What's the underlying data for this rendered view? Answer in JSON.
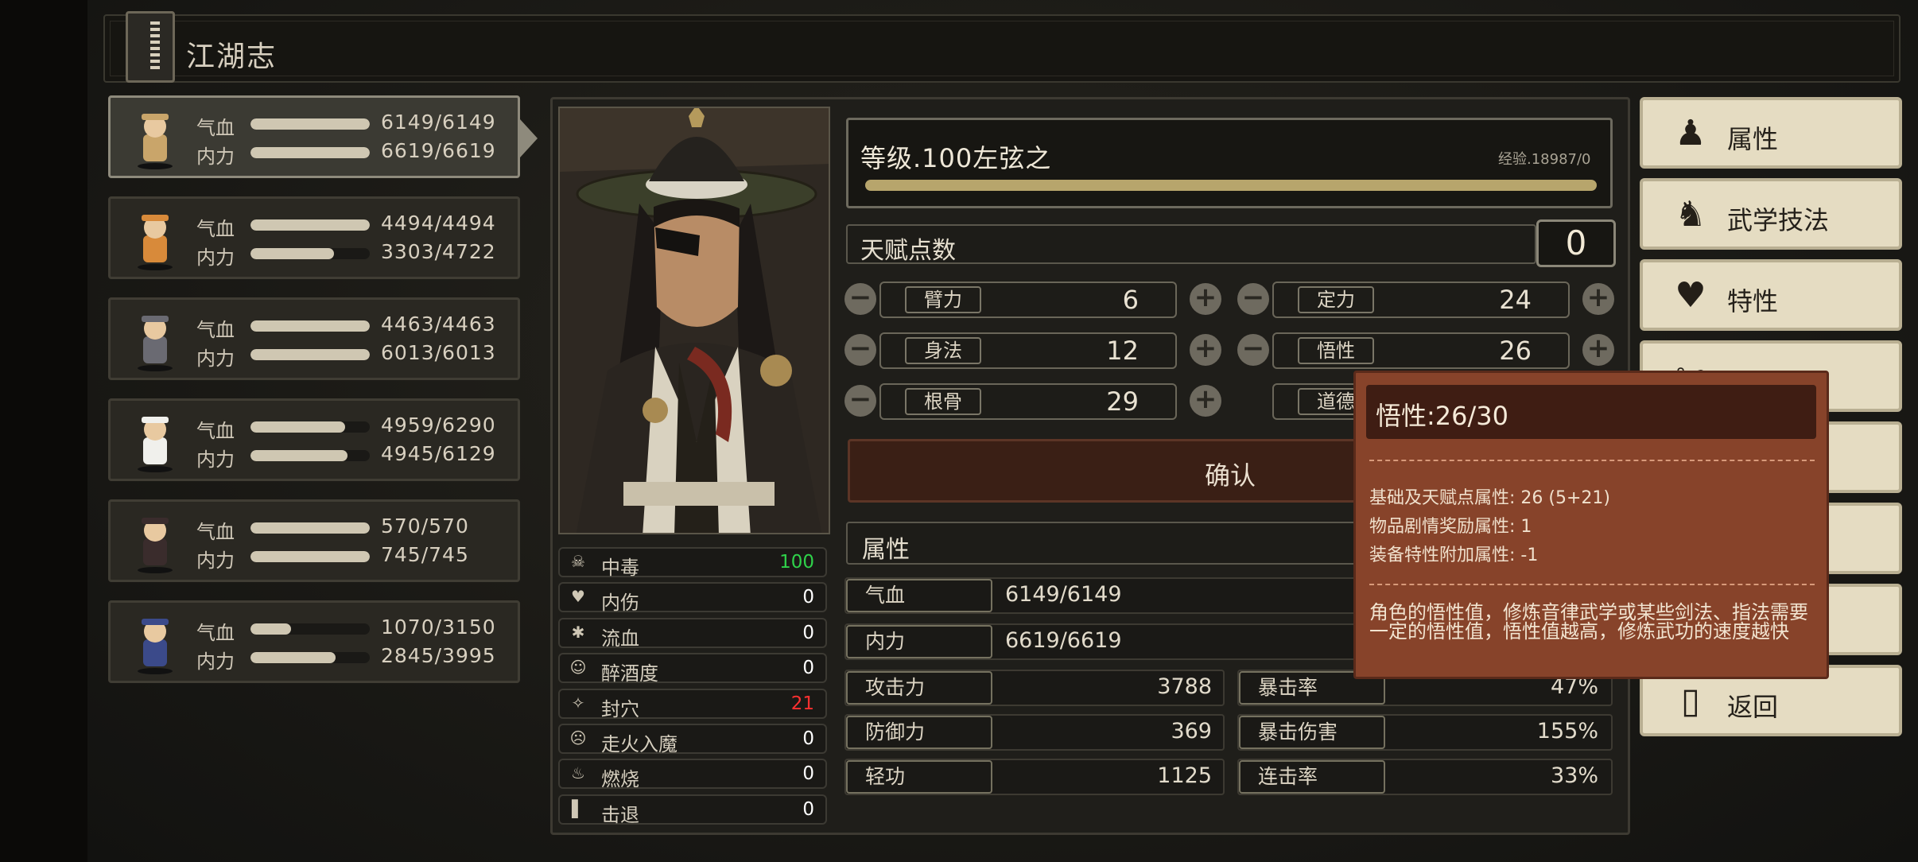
{
  "header": {
    "title": "江湖志"
  },
  "roster": [
    {
      "hp_label": "气血",
      "mp_label": "内力",
      "hp": "6149/6149",
      "mp": "6619/6619",
      "hp_frac": 1.0,
      "mp_frac": 1.0,
      "icon": "straw-hat-swordsman-icon"
    },
    {
      "hp_label": "气血",
      "mp_label": "内力",
      "hp": "4494/4494",
      "mp": "3303/4722",
      "hp_frac": 1.0,
      "mp_frac": 0.7,
      "icon": "fox-icon"
    },
    {
      "hp_label": "气血",
      "mp_label": "内力",
      "hp": "4463/4463",
      "mp": "6013/6013",
      "hp_frac": 1.0,
      "mp_frac": 1.0,
      "icon": "official-hat-man-icon"
    },
    {
      "hp_label": "气血",
      "mp_label": "内力",
      "hp": "4959/6290",
      "mp": "4945/6129",
      "hp_frac": 0.79,
      "mp_frac": 0.81,
      "icon": "white-goose-icon"
    },
    {
      "hp_label": "气血",
      "mp_label": "内力",
      "hp": "570/570",
      "mp": "745/745",
      "hp_frac": 1.0,
      "mp_frac": 1.0,
      "icon": "masked-ninja-icon"
    },
    {
      "hp_label": "气血",
      "mp_label": "内力",
      "hp": "1070/3150",
      "mp": "2845/3995",
      "hp_frac": 0.34,
      "mp_frac": 0.71,
      "icon": "blue-hat-fighter-icon"
    }
  ],
  "character": {
    "level_title": "等级.100左弦之",
    "exp": "经验.18987/0",
    "talent_label": "天赋点数",
    "talent_points": "0",
    "attributes": [
      {
        "name": "臂力",
        "value": "6"
      },
      {
        "name": "定力",
        "value": "24"
      },
      {
        "name": "身法",
        "value": "12"
      },
      {
        "name": "悟性",
        "value": "26"
      },
      {
        "name": "根骨",
        "value": "29"
      },
      {
        "name": "道德",
        "value": ""
      }
    ],
    "confirm_label": "确认"
  },
  "status_effects": [
    {
      "name": "中毒",
      "value": "100",
      "color": "#2fd14a",
      "icon": "skull-icon"
    },
    {
      "name": "内伤",
      "value": "0",
      "color": "#ffffff",
      "icon": "broken-heart-icon"
    },
    {
      "name": "流血",
      "value": "0",
      "color": "#ffffff",
      "icon": "blood-drop-icon"
    },
    {
      "name": "醉酒度",
      "value": "0",
      "color": "#ffffff",
      "icon": "dizzy-face-icon"
    },
    {
      "name": "封穴",
      "value": "21",
      "color": "#ff3030",
      "icon": "acupoint-seal-icon"
    },
    {
      "name": "走火入魔",
      "value": "0",
      "color": "#ffffff",
      "icon": "demon-face-icon"
    },
    {
      "name": "燃烧",
      "value": "0",
      "color": "#ffffff",
      "icon": "flame-icon"
    },
    {
      "name": "击退",
      "value": "0",
      "color": "#ffffff",
      "icon": "knockback-icon"
    }
  ],
  "stats": {
    "header": "属性",
    "hp_label": "气血",
    "hp": "6149/6149",
    "mp_label": "内力",
    "mp": "6619/6619",
    "left": [
      {
        "name": "攻击力",
        "value": "3788"
      },
      {
        "name": "防御力",
        "value": "369"
      },
      {
        "name": "轻功",
        "value": "1125"
      }
    ],
    "right": [
      {
        "name": "暴击率",
        "value": "47%"
      },
      {
        "name": "暴击伤害",
        "value": "155%"
      },
      {
        "name": "连击率",
        "value": "33%"
      }
    ]
  },
  "menu": [
    {
      "label": "属性",
      "icon": "attribute-figure-icon"
    },
    {
      "label": "武学技法",
      "icon": "martial-skill-icon"
    },
    {
      "label": "特性",
      "icon": "trait-heart-icon"
    },
    {
      "label": "",
      "icon": "equipment-icon"
    },
    {
      "label": "",
      "icon": ""
    },
    {
      "label": "",
      "icon": ""
    },
    {
      "label": "",
      "icon": ""
    },
    {
      "label": "返回",
      "icon": "door-icon"
    }
  ],
  "tooltip": {
    "title": "悟性:26/30",
    "lines": [
      "基础及天赋点属性: 26 (5+21)",
      "物品剧情奖励属性: 1",
      "装备特性附加属性: -1"
    ],
    "description": "角色的悟性值，修炼音律武学或某些剑法、指法需要一定的悟性值，悟性值越高，修炼武功的速度越快"
  }
}
